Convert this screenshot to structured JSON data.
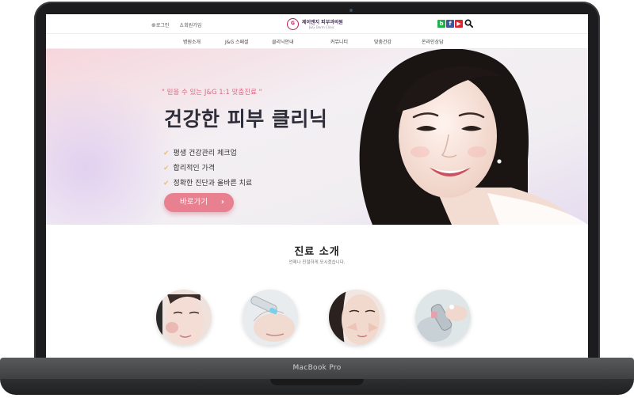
{
  "device": {
    "model_label": "MacBook Pro"
  },
  "header": {
    "login_label": "로그인",
    "join_label": "회원가입",
    "logo_text": "제이앤지 피부과의원",
    "logo_sub": "J&G Derm Clinic",
    "social_icons": [
      "blog-icon",
      "facebook-icon",
      "youtube-icon",
      "search-icon"
    ]
  },
  "nav": {
    "items": [
      "병원소개",
      "J&G 스페셜",
      "클리닉안내",
      "커뮤니티",
      "맞춤건강",
      "온라인상담"
    ]
  },
  "hero": {
    "tagline": "\" 믿을 수 있는 J&G 1:1 맞춤진료 \"",
    "title": "건강한 피부 클리닉",
    "features": [
      "평생 건강관리 체크업",
      "합리적인 가격",
      "정확한 진단과 올바른 치료"
    ],
    "cta_label": "바로가기"
  },
  "intro": {
    "title": "진료 소개",
    "subtitle": "언제나 친절하게 모시겠습니다."
  },
  "colors": {
    "accent": "#e8808f",
    "tagline": "#d86b86",
    "check": "#e9c36b",
    "blog": "#21b14b",
    "facebook": "#3b5998",
    "youtube": "#e0262c"
  }
}
